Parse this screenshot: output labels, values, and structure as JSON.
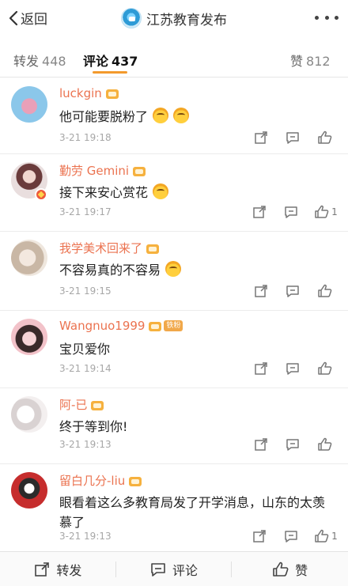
{
  "header": {
    "back_label": "返回",
    "title": "江苏教育发布"
  },
  "tabs": {
    "repost_label": "转发",
    "repost_count": "448",
    "comment_label": "评论",
    "comment_count": "437",
    "like_label": "赞",
    "like_count": "812"
  },
  "comments": [
    {
      "user": "luckgin",
      "text": "他可能要脱粉了",
      "time": "3-21 19:18",
      "likes": ""
    },
    {
      "user": "勤劳 Gemini",
      "text": "接下来安心赏花",
      "time": "3-21 19:17",
      "likes": "1"
    },
    {
      "user": "我学美术回来了",
      "text": "不容易真的不容易",
      "time": "3-21 19:15",
      "likes": ""
    },
    {
      "user": "Wangnuo1999",
      "badge": "铁粉",
      "text": "宝贝爱你",
      "time": "3-21 19:14",
      "likes": ""
    },
    {
      "user": "阿-已",
      "text": "终于等到你!",
      "time": "3-21 19:13",
      "likes": ""
    },
    {
      "user": "留白几分-liu",
      "text": "眼看着这么多教育局发了开学消息，山东的太羡慕了",
      "time": "3-21 19:13",
      "likes": "1"
    }
  ],
  "bottom": {
    "repost_label": "转发",
    "comment_label": "评论",
    "like_label": "赞"
  },
  "colors": {
    "accent": "#f39a2c",
    "username": "#eb7350",
    "time": "#a7a7a7"
  },
  "icons": [
    "chevron-left-icon",
    "more-dots-icon",
    "share-icon",
    "comment-icon",
    "thumbs-up-icon"
  ]
}
